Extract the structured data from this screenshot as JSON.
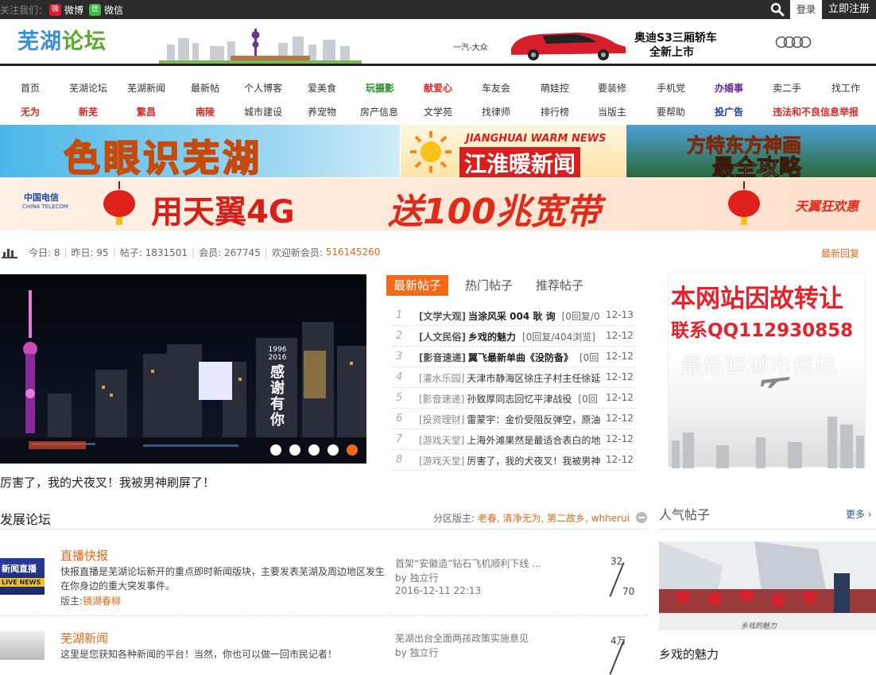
{
  "topbar": {
    "follow_label": "关注我们：",
    "weibo_label": "微博",
    "weixin_label": "微信",
    "login_label": "登录",
    "register_label": "立即注册"
  },
  "header": {
    "logo_part1": "芜湖",
    "logo_part2": "论坛",
    "ad_brand": "一汽-大众",
    "ad_title": "奥迪S3三厢轿车",
    "ad_subtitle": "全新上市"
  },
  "nav_row1": [
    {
      "label": "首页",
      "style": ""
    },
    {
      "label": "芜湖论坛",
      "style": ""
    },
    {
      "label": "芜湖新闻",
      "style": ""
    },
    {
      "label": "最新帖",
      "style": ""
    },
    {
      "label": "个人博客",
      "style": ""
    },
    {
      "label": "爱美食",
      "style": ""
    },
    {
      "label": "玩摄影",
      "style": "green"
    },
    {
      "label": "献爱心",
      "style": "red"
    },
    {
      "label": "车友会",
      "style": ""
    },
    {
      "label": "萌娃控",
      "style": ""
    },
    {
      "label": "要装修",
      "style": ""
    },
    {
      "label": "手机党",
      "style": ""
    },
    {
      "label": "办婚事",
      "style": "purple"
    },
    {
      "label": "卖二手",
      "style": ""
    },
    {
      "label": "找工作",
      "style": ""
    }
  ],
  "nav_row2": [
    {
      "label": "无为",
      "style": "red"
    },
    {
      "label": "新芜",
      "style": "red"
    },
    {
      "label": "繁昌",
      "style": "red"
    },
    {
      "label": "南陵",
      "style": "red"
    },
    {
      "label": "城市建设",
      "style": ""
    },
    {
      "label": "养宠物",
      "style": ""
    },
    {
      "label": "房产信息",
      "style": ""
    },
    {
      "label": "文学苑",
      "style": ""
    },
    {
      "label": "找律师",
      "style": ""
    },
    {
      "label": "排行榜",
      "style": ""
    },
    {
      "label": "当版主",
      "style": ""
    },
    {
      "label": "要帮助",
      "style": ""
    },
    {
      "label": "投广告",
      "style": "blue"
    },
    {
      "label": "违法和不良信息举报",
      "style": "red"
    }
  ],
  "banners": {
    "b1_text": "色眼识芜湖",
    "b2_en": "JIANGHUAI WARM NEWS",
    "b2_cn": "江淮暖新闻",
    "b3_line1": "方特东方神画",
    "b3_line2": "最全攻略",
    "b4_brand": "中国电信",
    "b4_brand_en": "CHINA TELECOM",
    "b4_text1": "用天翼4G",
    "b4_text2": "送100兆宽带",
    "b4_tag": "天翼狂欢惠"
  },
  "stats": {
    "today": "今日: 8",
    "yesterday": "昨日: 95",
    "posts": "帖子: 1831501",
    "members": "会员: 267745",
    "welcome": "欢迎新会员:",
    "new_member": "516145260",
    "latest_reply": "最新回复"
  },
  "slider": {
    "caption": "厉害了，我的犬夜叉！我被男神刷屏了！",
    "billboard_year1": "1996",
    "billboard_year2": "2016",
    "billboard_text": "感谢有你",
    "dots": 5,
    "active_dot": 5
  },
  "tabs": [
    {
      "label": "最新帖子",
      "active": true
    },
    {
      "label": "热门帖子",
      "active": false
    },
    {
      "label": "推荐帖子",
      "active": false
    }
  ],
  "posts": [
    {
      "num": "1",
      "cat": "[文学大观]",
      "title": "当涂风采 004 耿 询",
      "extra": "[0回复/0",
      "date": "12-13",
      "bold": true
    },
    {
      "num": "2",
      "cat": "[人文民俗]",
      "title": "乡戏的魅力",
      "extra": "[0回复/404浏览]",
      "date": "12-12",
      "bold": true
    },
    {
      "num": "3",
      "cat": "[影音速递]",
      "title": "翼飞最新单曲《没防备》",
      "extra": "[0回",
      "date": "12-12",
      "bold": true
    },
    {
      "num": "4",
      "cat": "[灌水乐园]",
      "title": "天津市静海区徐庄子村主任徐延",
      "extra": "",
      "date": "12-12",
      "bold": false
    },
    {
      "num": "5",
      "cat": "[影音速递]",
      "title": "孙致厚同志回忆平津战役",
      "extra": "[0回",
      "date": "12-12",
      "bold": false
    },
    {
      "num": "6",
      "cat": "[投资理财]",
      "title": "雷蒙宇：金价受阻反弹空，原油",
      "extra": "",
      "date": "12-12",
      "bold": false
    },
    {
      "num": "7",
      "cat": "[游戏天堂]",
      "title": "上海外滩果然是最适合表白的地",
      "extra": "",
      "date": "12-12",
      "bold": false
    },
    {
      "num": "8",
      "cat": "[游戏天堂]",
      "title": "厉害了，我的犬夜叉！我被男神",
      "extra": "",
      "date": "12-12",
      "bold": false
    }
  ],
  "side_ad": {
    "line1": "本网站因故转让",
    "line2": "联系QQ112930858",
    "line3": "最新鲜城市资讯"
  },
  "forum_section": {
    "title": "发展论坛",
    "mods_label": "分区版主:",
    "mods": "老春, 清净无为, 第二故乡, whherui"
  },
  "forums": [
    {
      "name": "直播快报",
      "thumb_text": "新闻直播",
      "thumb_sub": "LIVE NEWS",
      "desc": "快报直播是芜湖论坛新开的重点即时新闻版块，主要发表芜湖及周边地区发生在你身边的重大突发事件。",
      "mod_label": "版主:",
      "mod_name": "镜湖春柳",
      "last_title": "首架“安徽造”钻石飞机顺利下线 ...",
      "last_by": "by 独立行",
      "last_time": "2016-12-11 22:13",
      "count1": "32",
      "count2": "70"
    },
    {
      "name": "芜湖新闻",
      "thumb_text": "",
      "thumb_sub": "",
      "desc": "这里是您获知各种新闻的平台！当然，你也可以做一回市民记者！",
      "mod_label": "",
      "mod_name": "",
      "last_title": "芜湖出台全面两孩政策实施意见",
      "last_by": "by 独立行",
      "last_time": "",
      "count1": "4万",
      "count2": ""
    }
  ],
  "hot": {
    "title": "人气帖子",
    "more": "更多",
    "img_caption": "乡戏的魅力",
    "caption": "乡戏的魅力"
  },
  "colors": {
    "accent": "#f06a1a",
    "topbar": "#2b2b2b",
    "red": "#e8202a"
  }
}
